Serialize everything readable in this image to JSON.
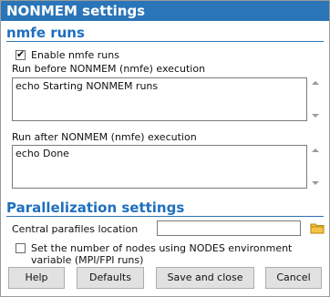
{
  "window": {
    "title": "NONMEM settings"
  },
  "nmfe": {
    "section_title": "nmfe runs",
    "enable_label": "Enable nmfe runs",
    "enable_checked": true,
    "before_label": "Run before NONMEM (nmfe) execution",
    "before_value": "echo Starting NONMEM runs",
    "after_label": "Run after NONMEM (nmfe) execution",
    "after_value": "echo Done"
  },
  "parallel": {
    "section_title": "Parallelization settings",
    "parafiles_label": "Central parafiles location",
    "parafiles_value": "",
    "nodes_label_line1": "Set the number of nodes using NODES environment",
    "nodes_label_line2": "variable (MPI/FPI runs)",
    "nodes_checked": false
  },
  "buttons": {
    "help": "Help",
    "defaults": "Defaults",
    "save_close": "Save and close",
    "cancel": "Cancel"
  },
  "icons": {
    "folder": "folder-icon",
    "checkmark": "checkmark-icon",
    "scroll_up": "scroll-up-arrow-icon",
    "scroll_down": "scroll-down-arrow-icon"
  },
  "colors": {
    "title_bar": "#2a74b8",
    "section_title": "#1f6fbf"
  }
}
